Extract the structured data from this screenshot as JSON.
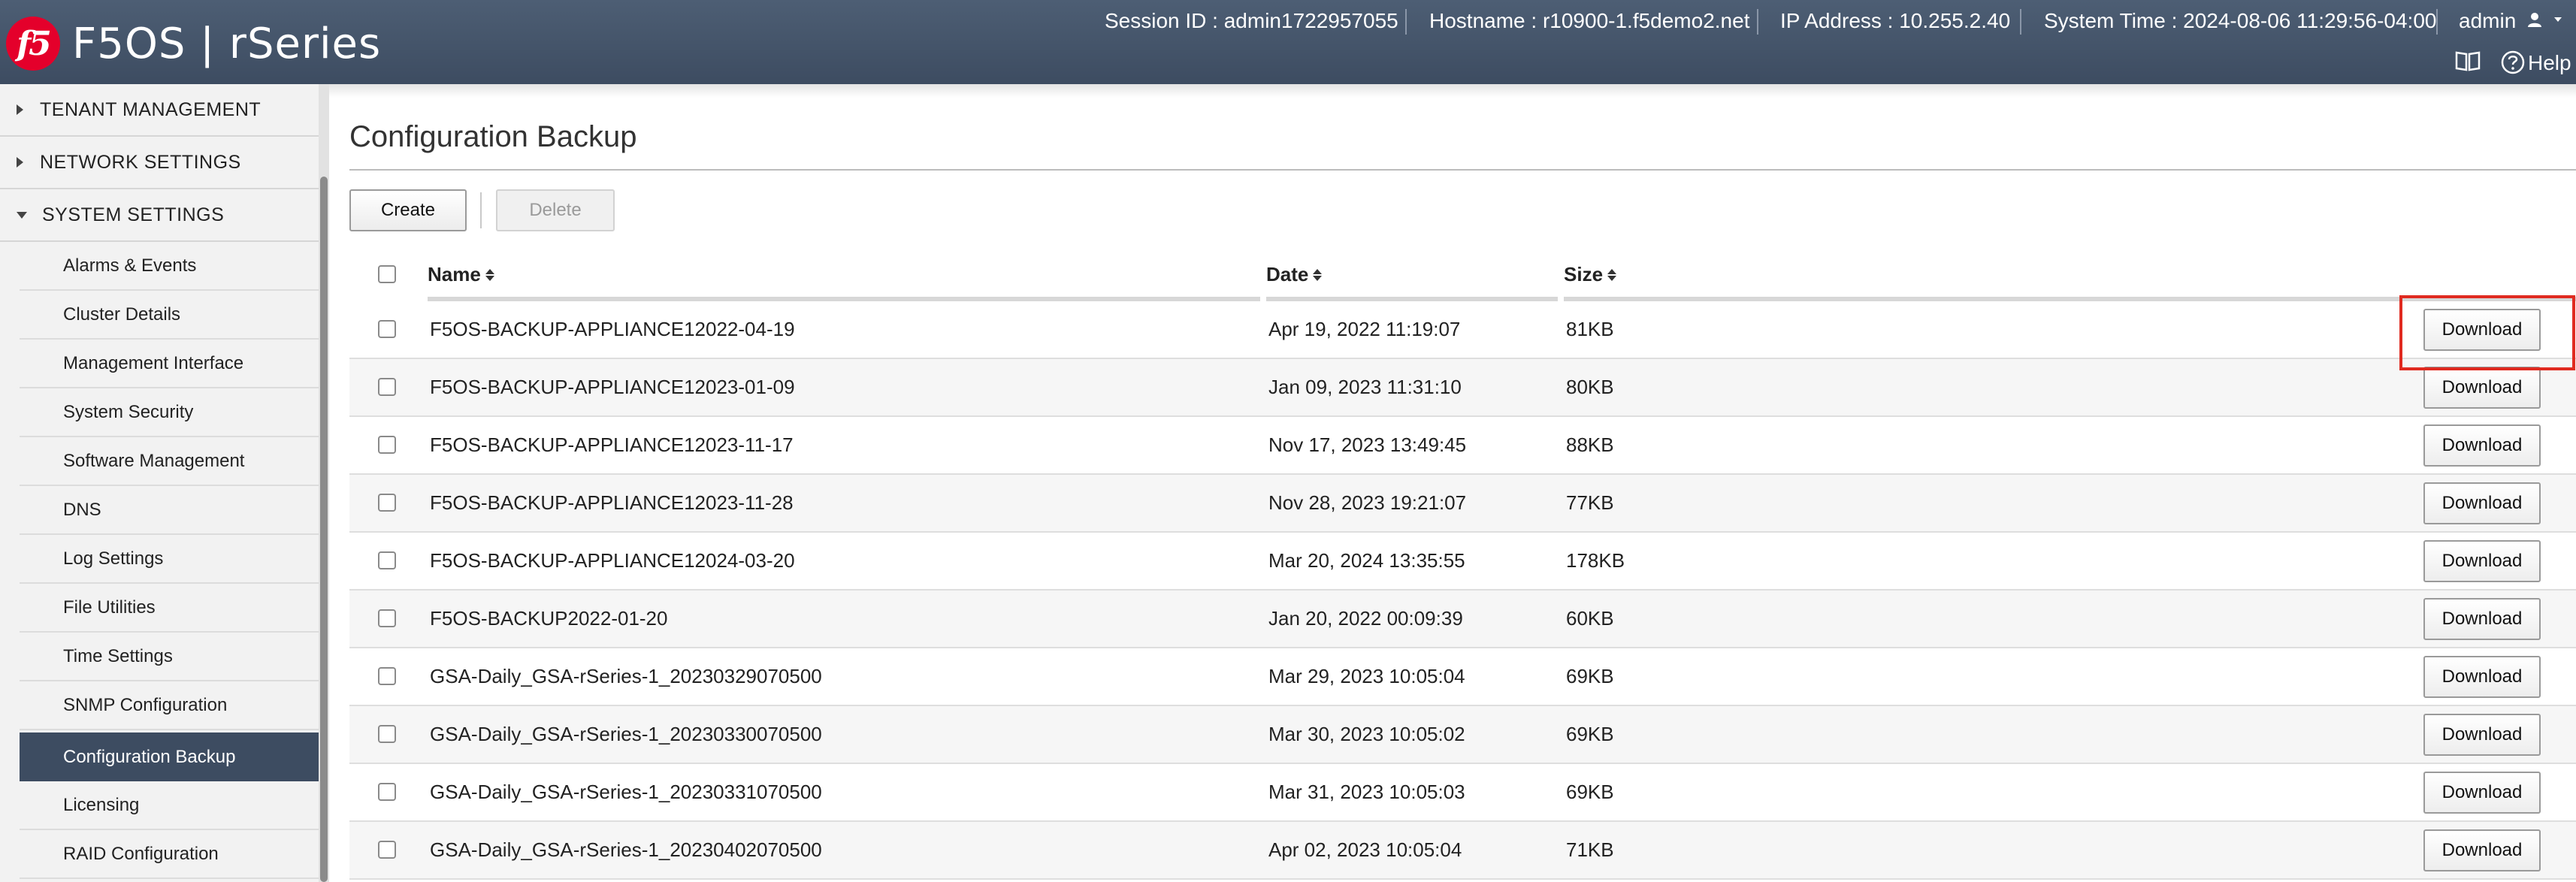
{
  "header": {
    "logo_text": "f5",
    "product_name": "F5OS | rSeries",
    "session_id": "Session ID : admin1722957055",
    "hostname": "Hostname : r10900-1.f5demo2.net",
    "ip_address": "IP Address : 10.255.2.40",
    "system_time": "System Time : 2024-08-06 11:29:56-04:00",
    "user": "admin",
    "help_label": "Help",
    "colors": {
      "bar": "#46566c",
      "logo": "#e4002b"
    }
  },
  "sidebar": {
    "sections": [
      {
        "label": "TENANT MANAGEMENT",
        "expanded": false
      },
      {
        "label": "NETWORK SETTINGS",
        "expanded": false
      },
      {
        "label": "SYSTEM SETTINGS",
        "expanded": true
      }
    ],
    "items": [
      {
        "label": "Alarms & Events"
      },
      {
        "label": "Cluster Details"
      },
      {
        "label": "Management Interface"
      },
      {
        "label": "System Security"
      },
      {
        "label": "Software Management"
      },
      {
        "label": "DNS"
      },
      {
        "label": "Log Settings"
      },
      {
        "label": "File Utilities"
      },
      {
        "label": "Time Settings"
      },
      {
        "label": "SNMP Configuration"
      },
      {
        "label": "Configuration Backup",
        "active": true
      },
      {
        "label": "Licensing"
      },
      {
        "label": "RAID Configuration"
      }
    ],
    "colors": {
      "active_bg": "#3d4c61"
    }
  },
  "main": {
    "title": "Configuration Backup",
    "toolbar": {
      "create_label": "Create",
      "delete_label": "Delete"
    },
    "table": {
      "columns": {
        "name": "Name",
        "date": "Date",
        "size": "Size"
      },
      "download_label": "Download",
      "rows": [
        {
          "name": "F5OS-BACKUP-APPLIANCE12022-04-19",
          "date": "Apr 19, 2022 11:19:07",
          "size": "81KB"
        },
        {
          "name": "F5OS-BACKUP-APPLIANCE12023-01-09",
          "date": "Jan 09, 2023 11:31:10",
          "size": "80KB"
        },
        {
          "name": "F5OS-BACKUP-APPLIANCE12023-11-17",
          "date": "Nov 17, 2023 13:49:45",
          "size": "88KB"
        },
        {
          "name": "F5OS-BACKUP-APPLIANCE12023-11-28",
          "date": "Nov 28, 2023 19:21:07",
          "size": "77KB"
        },
        {
          "name": "F5OS-BACKUP-APPLIANCE12024-03-20",
          "date": "Mar 20, 2024 13:35:55",
          "size": "178KB"
        },
        {
          "name": "F5OS-BACKUP2022-01-20",
          "date": "Jan 20, 2022 00:09:39",
          "size": "60KB"
        },
        {
          "name": "GSA-Daily_GSA-rSeries-1_20230329070500",
          "date": "Mar 29, 2023 10:05:04",
          "size": "69KB"
        },
        {
          "name": "GSA-Daily_GSA-rSeries-1_20230330070500",
          "date": "Mar 30, 2023 10:05:02",
          "size": "69KB"
        },
        {
          "name": "GSA-Daily_GSA-rSeries-1_20230331070500",
          "date": "Mar 31, 2023 10:05:03",
          "size": "69KB"
        },
        {
          "name": "GSA-Daily_GSA-rSeries-1_20230402070500",
          "date": "Apr 02, 2023 10:05:04",
          "size": "71KB"
        }
      ]
    },
    "highlight_color": "#e02a20"
  }
}
